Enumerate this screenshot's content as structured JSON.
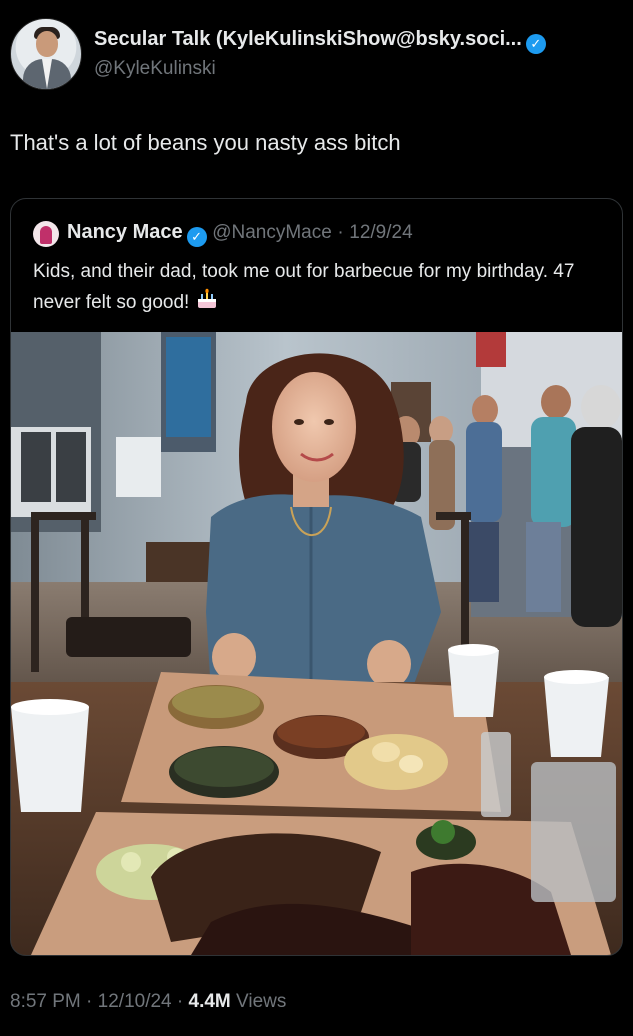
{
  "tweet": {
    "author_name": "Secular Talk (KyleKulinskiShow@bsky.soci...",
    "author_handle": "@KyleKulinski",
    "text": "That's a lot of beans you nasty ass bitch",
    "verified_icon": "verified-badge-icon",
    "accent_color": "#1d9bf0"
  },
  "quoted": {
    "author_name": "Nancy Mace",
    "author_handle": "@NancyMace",
    "separator": "·",
    "date": "12/9/24",
    "text": "Kids, and their dad, took me out for barbecue for my birthday. 47 never felt so good!",
    "emoji_icon": "birthday-cake-icon"
  },
  "footer": {
    "time": "8:57 PM",
    "separator": "·",
    "date": "12/10/24",
    "views_count": "4.4M",
    "views_label": "Views"
  }
}
